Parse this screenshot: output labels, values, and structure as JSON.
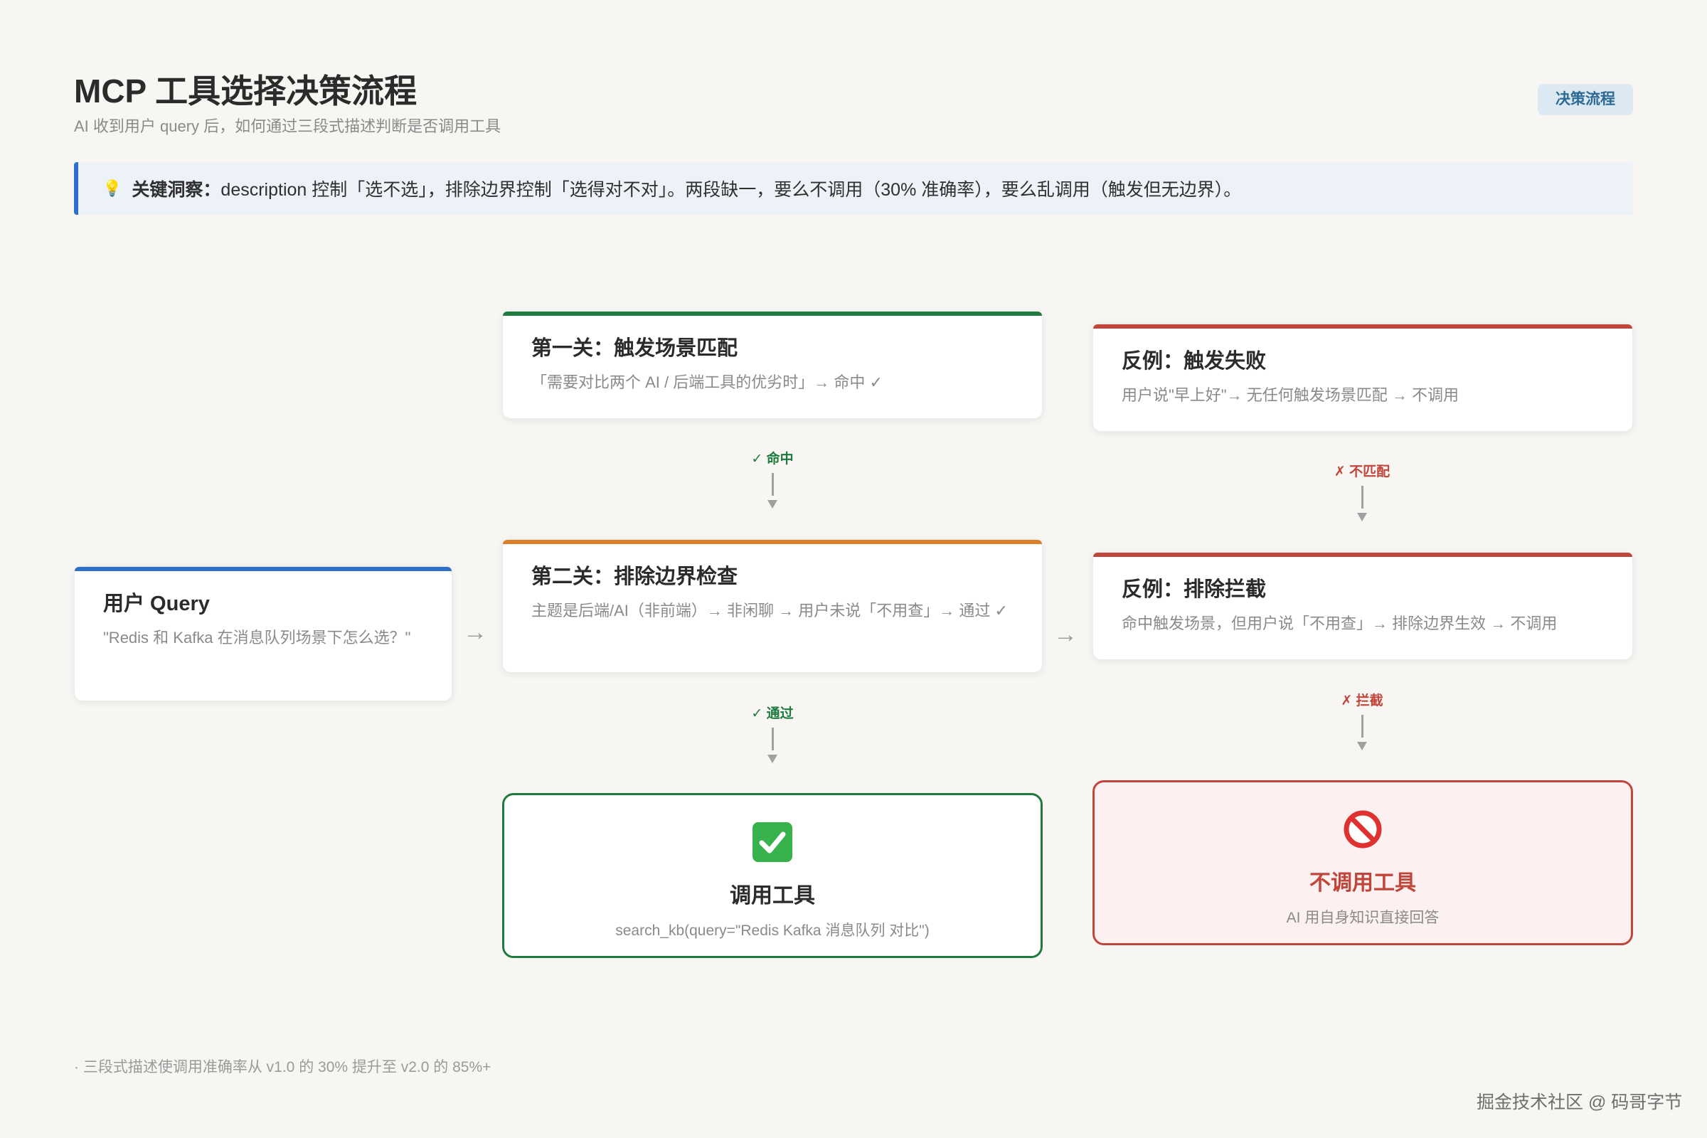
{
  "header": {
    "title": "MCP 工具选择决策流程",
    "subtitle": "AI 收到用户 query 后，如何通过三段式描述判断是否调用工具",
    "badge": "决策流程"
  },
  "insight": {
    "lead": "关键洞察：",
    "text": "description 控制「选不选」，排除边界控制「选得对不对」。两段缺一，要么不调用（30% 准确率），要么乱调用（触发但无边界）。"
  },
  "nodes": {
    "query": {
      "title": "用户 Query",
      "desc": "\"Redis 和 Kafka 在消息队列场景下怎么选？\""
    },
    "stage1": {
      "title": "第一关：触发场景匹配",
      "desc": "「需要对比两个 AI / 后端工具的优劣时」→ 命中 ✓"
    },
    "stage2": {
      "title": "第二关：排除边界检查",
      "desc": "主题是后端/AI（非前端）→ 非闲聊 → 用户未说「不用查」→ 通过 ✓"
    },
    "fail1": {
      "title": "反例：触发失败",
      "desc": "用户说\"早上好\"→ 无任何触发场景匹配 → 不调用"
    },
    "fail2": {
      "title": "反例：排除拦截",
      "desc": "命中触发场景，但用户说「不用查」→ 排除边界生效 → 不调用"
    },
    "call": {
      "title": "调用工具",
      "desc": "search_kb(query=\"Redis Kafka 消息队列 对比\")"
    },
    "nocall": {
      "title": "不调用工具",
      "desc": "AI 用自身知识直接回答"
    }
  },
  "links": {
    "hit": "✓ 命中",
    "pass": "✓ 通过",
    "nomatch": "✗ 不匹配",
    "blocked": "✗ 拦截",
    "arrow": "→"
  },
  "colors": {
    "blue": "#2e6fc9",
    "green": "#1e7a3f",
    "orange": "#d9822b",
    "red": "#c0453a"
  },
  "footer": {
    "note": "· 三段式描述使调用准确率从 v1.0 的 30% 提升至 v2.0 的 85%+",
    "watermark": "掘金技术社区 @ 码哥字节"
  }
}
